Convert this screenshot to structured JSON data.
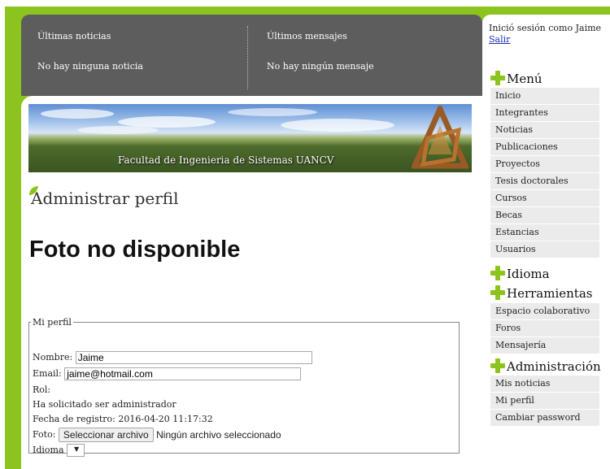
{
  "news": {
    "latest_news_title": "Últimas noticias",
    "latest_news_empty": "No hay ninguna noticia",
    "latest_messages_title": "Últimos mensajes",
    "latest_messages_empty": "No hay ningún mensaje"
  },
  "banner": {
    "title": "Facultad de Ingenieria de Sistemas UANCV"
  },
  "page": {
    "title": "Administrar perfil",
    "photo_placeholder": "Foto no disponible"
  },
  "profile": {
    "legend": "Mi perfil",
    "name_label": "Nombre:",
    "name_value": "Jaime",
    "email_label": "Email:",
    "email_value": "jaime@hotmail.com",
    "role_label": "Rol:",
    "admin_request": "Ha solicitado ser administrador",
    "registration_label": "Fecha de registro:",
    "registration_value": "2016-04-20 11:17:32",
    "photo_label": "Foto:",
    "file_button": "Seleccionar archivo",
    "file_none": "Ningún archivo seleccionado",
    "language_label": "Idioma",
    "language_value": ""
  },
  "sidebar": {
    "logged_in_text": "Inició sesión como Jaime",
    "logout_label": "Salir",
    "menu_title": "Menú",
    "menu_items": [
      "Inicio",
      "Integrantes",
      "Noticias",
      "Publicaciones",
      "Proyectos",
      "Tesis doctorales",
      "Cursos",
      "Becas",
      "Estancias",
      "Usuarios"
    ],
    "language_title": "Idioma",
    "tools_title": "Herramientas",
    "tools_items": [
      "Espacio colaborativo",
      "Foros",
      "Mensajería"
    ],
    "admin_title": "Administración",
    "admin_items": [
      "Mis noticias",
      "Mi perfil",
      "Cambiar password"
    ]
  },
  "colors": {
    "accent_green": "#8cc31e",
    "news_bar": "#5d5d5d",
    "link_blue": "#1b2fb8"
  }
}
